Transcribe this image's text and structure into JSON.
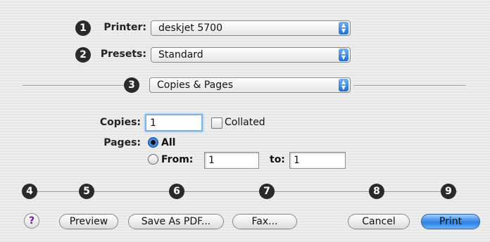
{
  "header": {
    "printer_label": "Printer:",
    "printer_value": "deskjet 5700",
    "presets_label": "Presets:",
    "presets_value": "Standard",
    "panel_value": "Copies & Pages"
  },
  "copies_pages": {
    "copies_label": "Copies:",
    "copies_value": "1",
    "collated_label": "Collated",
    "pages_label": "Pages:",
    "all_label": "All",
    "from_label": "From:",
    "from_value": "1",
    "to_label": "to:",
    "to_value": "1"
  },
  "callouts": [
    "1",
    "2",
    "3",
    "4",
    "5",
    "6",
    "7",
    "8",
    "9"
  ],
  "buttons": {
    "help": "?",
    "preview": "Preview",
    "save_pdf": "Save As PDF...",
    "fax": "Fax...",
    "cancel": "Cancel",
    "print": "Print"
  },
  "colors": {
    "accent": "#2d7fe0",
    "callout": "#2a2a2a",
    "help": "#7a1aa8"
  }
}
